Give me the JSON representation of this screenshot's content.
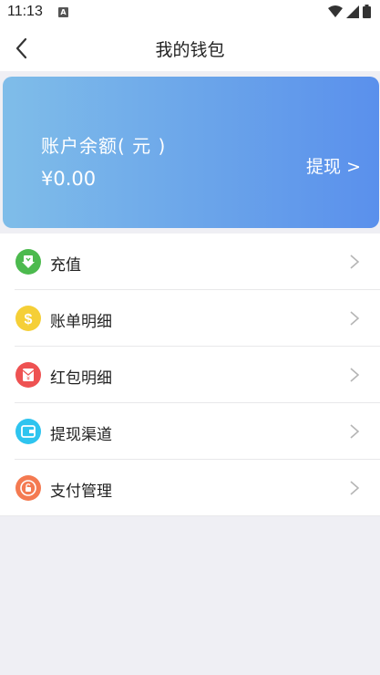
{
  "status_bar": {
    "time": "11:13",
    "notification_badge": "A",
    "icons": [
      "wifi-icon",
      "signal-icon",
      "battery-icon"
    ]
  },
  "nav": {
    "title": "我的钱包",
    "back_icon": "back-arrow-icon"
  },
  "balance_card": {
    "label": "账户余额( 元 )",
    "amount": "¥0.00",
    "withdraw_label": "提现 >",
    "gradient_colors": [
      "#7fbde9",
      "#5a90ec"
    ]
  },
  "menu": {
    "items": [
      {
        "label": "充值",
        "icon": "recharge-icon",
        "icon_color": "#4cba4e"
      },
      {
        "label": "账单明细",
        "icon": "bill-dollar-icon",
        "icon_color": "#f5cf37"
      },
      {
        "label": "红包明细",
        "icon": "red-envelope-icon",
        "icon_color": "#ee5252"
      },
      {
        "label": "提现渠道",
        "icon": "wallet-icon",
        "icon_color": "#2ec4ef"
      },
      {
        "label": "支付管理",
        "icon": "payment-lock-icon",
        "icon_color": "#f47a51"
      }
    ]
  }
}
